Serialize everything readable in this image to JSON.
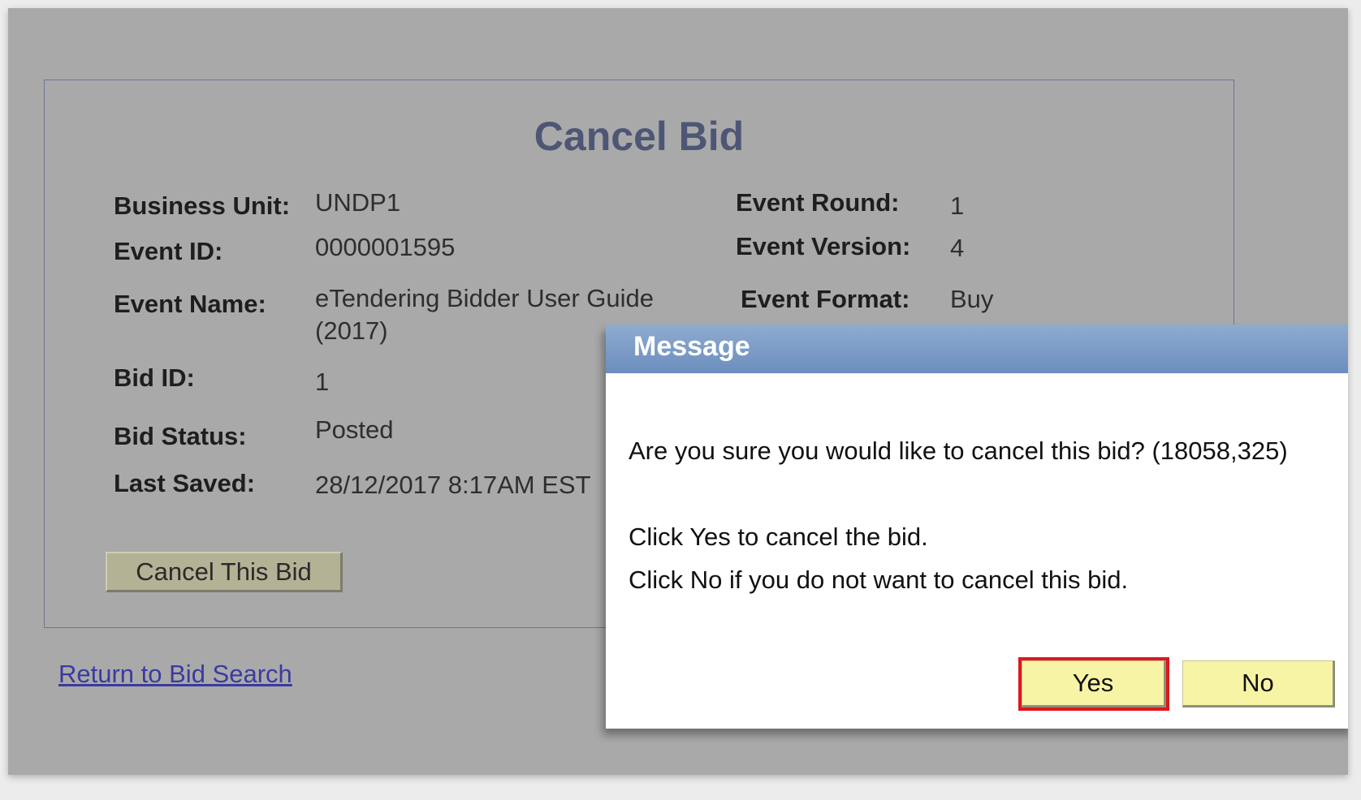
{
  "page": {
    "title": "Cancel Bid"
  },
  "details": {
    "business_unit_label": "Business Unit:",
    "business_unit_value": "UNDP1",
    "event_id_label": "Event ID:",
    "event_id_value": "0000001595",
    "event_name_label": "Event Name:",
    "event_name_value": "eTendering Bidder User Guide (2017)",
    "bid_id_label": "Bid ID:",
    "bid_id_value": "1",
    "bid_status_label": "Bid Status:",
    "bid_status_value": "Posted",
    "last_saved_label": "Last Saved:",
    "last_saved_value": "28/12/2017  8:17AM EST",
    "event_round_label": "Event Round:",
    "event_round_value": "1",
    "event_version_label": "Event Version:",
    "event_version_value": "4",
    "event_format_label": "Event Format:",
    "event_format_value": "Buy"
  },
  "actions": {
    "cancel_bid_label": "Cancel This Bid",
    "return_link_label": "Return to Bid Search"
  },
  "dialog": {
    "title": "Message",
    "question": "Are you sure you would like to cancel this bid? (18058,325)",
    "line_yes": "Click Yes to cancel the bid.",
    "line_no": "Click No if you do not want to cancel this bid.",
    "yes_label": "Yes",
    "no_label": "No",
    "highlight_color": "#e0161c",
    "header_color": "#7b9cc7"
  }
}
